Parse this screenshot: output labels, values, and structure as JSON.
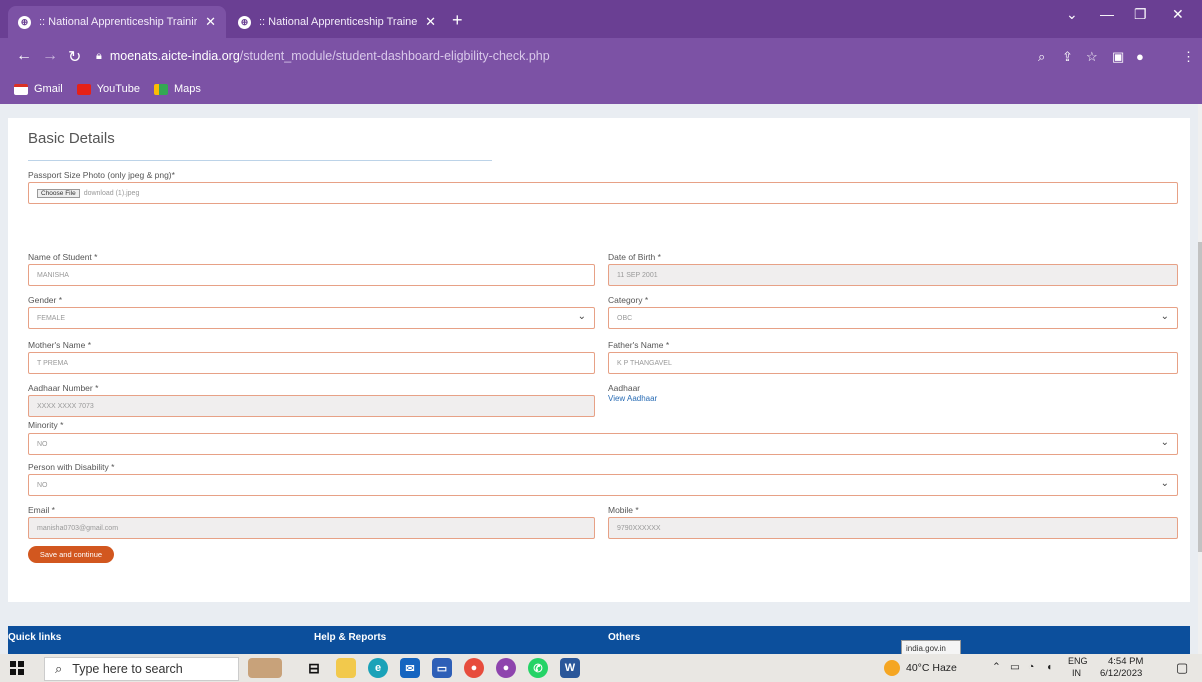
{
  "browser": {
    "tabs": [
      {
        "title": ":: National Apprenticeship Trainir"
      },
      {
        "title": ":: National Apprenticeship Traine"
      }
    ],
    "url_host": "moenats.aicte-india.org",
    "url_path": "/student_module/student-dashboard-eligbility-check.php",
    "bookmarks": [
      {
        "label": "Gmail"
      },
      {
        "label": "YouTube"
      },
      {
        "label": "Maps"
      }
    ]
  },
  "form": {
    "section_title": "Basic Details",
    "photo_label": "Passport Size Photo (only jpeg & png)*",
    "file_button": "Choose File",
    "file_name": "download (1).jpeg",
    "name_label": "Name of Student *",
    "name_value": "MANISHA",
    "dob_label": "Date of Birth *",
    "dob_value": "11 SEP 2001",
    "gender_label": "Gender *",
    "gender_value": "FEMALE",
    "category_label": "Category *",
    "category_value": "OBC",
    "mother_label": "Mother's Name *",
    "mother_value": "T PREMA",
    "father_label": "Father's Name *",
    "father_value": "K P THANGAVEL",
    "aadhaar_num_label": "Aadhaar Number *",
    "aadhaar_num_value": "XXXX XXXX 7073",
    "aadhaar_label": "Aadhaar",
    "view_aadhaar": "View Aadhaar",
    "minority_label": "Minority *",
    "minority_value": "NO",
    "disability_label": "Person with Disability *",
    "disability_value": "NO",
    "email_label": "Email *",
    "email_value": "manisha0703@gmail.com",
    "mobile_label": "Mobile *",
    "mobile_value": "9790XXXXXX",
    "save_button": "Save and continue"
  },
  "footer": {
    "quick_links": "Quick links",
    "help_reports": "Help & Reports",
    "others": "Others",
    "tooltip": "india.gov.in"
  },
  "taskbar": {
    "search_placeholder": "Type here to search",
    "weather": "40°C  Haze",
    "lang": "ENG",
    "region": "IN",
    "time": "4:54 PM",
    "date": "6/12/2023"
  },
  "colors": {
    "chrome": "#6a3f93",
    "footer": "#0c4f9c",
    "save_button": "#d2571f",
    "field_border": "#e7a186"
  }
}
